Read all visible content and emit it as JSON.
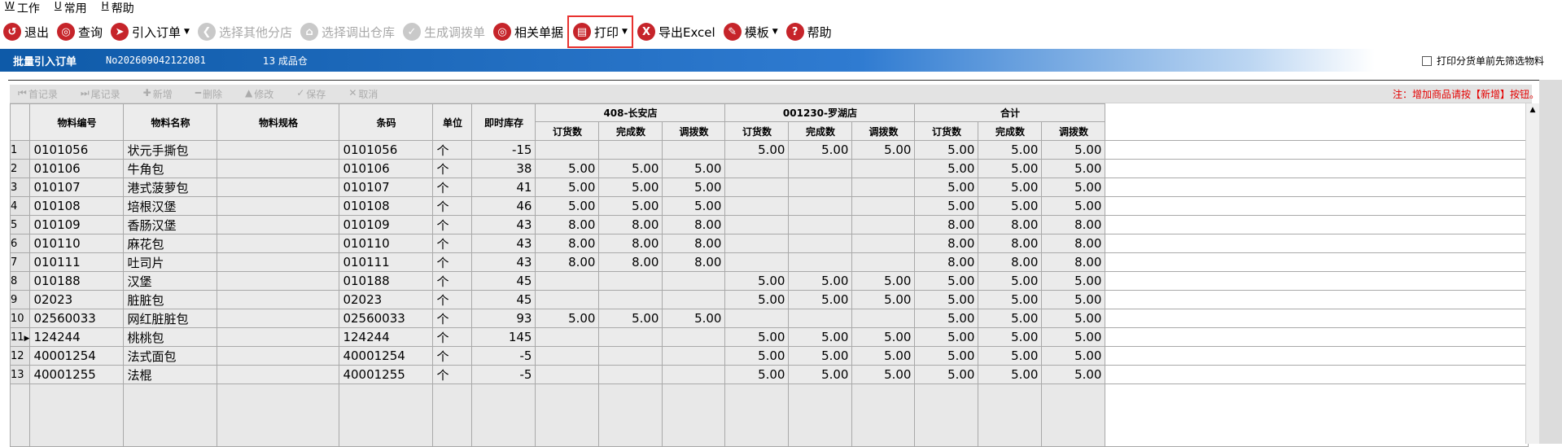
{
  "menu": [
    {
      "key": "W",
      "label": "工作"
    },
    {
      "key": "U",
      "label": "常用"
    },
    {
      "key": "H",
      "label": "帮助"
    }
  ],
  "toolbar": [
    {
      "label": "退出",
      "icon": "exit-icon",
      "glyph": "↺",
      "disabled": false
    },
    {
      "label": "查询",
      "icon": "search-icon",
      "glyph": "◎",
      "disabled": false
    },
    {
      "label": "引入订单",
      "icon": "import-order-icon",
      "glyph": "➤",
      "disabled": false,
      "dropdown": true
    },
    {
      "label": "选择其他分店",
      "icon": "back-icon",
      "glyph": "❮",
      "disabled": true
    },
    {
      "label": "选择调出仓库",
      "icon": "home-icon",
      "glyph": "⌂",
      "disabled": true
    },
    {
      "label": "生成调拨单",
      "icon": "check-icon",
      "glyph": "✓",
      "disabled": true
    },
    {
      "label": "相关单据",
      "icon": "related-docs-icon",
      "glyph": "◎",
      "disabled": false
    },
    {
      "label": "打印",
      "icon": "printer-icon",
      "glyph": "▤",
      "disabled": false,
      "dropdown": true,
      "highlight": true
    },
    {
      "label": "导出Excel",
      "icon": "export-excel-icon",
      "glyph": "X",
      "disabled": false
    },
    {
      "label": "模板",
      "icon": "template-icon",
      "glyph": "✎",
      "disabled": false,
      "dropdown": true
    },
    {
      "label": "帮助",
      "icon": "help-icon",
      "glyph": "?",
      "disabled": false
    }
  ],
  "strip": {
    "title": "批量引入订单",
    "doc_no": "No202609042122081",
    "warehouse": "13 成品仓",
    "checkbox_label": "打印分货单前先筛选物料"
  },
  "grid_toolbar": [
    {
      "label": "首记录",
      "glyph": "⏮"
    },
    {
      "label": "尾记录",
      "glyph": "⏭"
    },
    {
      "label": "新增",
      "glyph": "✚"
    },
    {
      "label": "删除",
      "glyph": "━"
    },
    {
      "label": "修改",
      "glyph": "▲"
    },
    {
      "label": "保存",
      "glyph": "✓"
    },
    {
      "label": "取消",
      "glyph": "✕"
    }
  ],
  "note": "注：增加商品请按【新增】按钮。",
  "table": {
    "headers": [
      "物料编号",
      "物料名称",
      "物料规格",
      "条码",
      "单位",
      "即时库存"
    ],
    "groups": [
      "408-长安店",
      "001230-罗湖店",
      "合计"
    ],
    "sub_headers": [
      "订货数",
      "完成数",
      "调拨数"
    ],
    "rows": [
      {
        "n": "1",
        "code": "0101056",
        "name": "状元手撕包",
        "spec": "",
        "barcode": "0101056",
        "unit": "个",
        "stock": "-15",
        "g1": [
          "",
          "",
          ""
        ],
        "g2": [
          "5.00",
          "5.00",
          "5.00"
        ],
        "g3": [
          "5.00",
          "5.00",
          "5.00"
        ]
      },
      {
        "n": "2",
        "code": "010106",
        "name": "牛角包",
        "spec": "",
        "barcode": "010106",
        "unit": "个",
        "stock": "38",
        "g1": [
          "5.00",
          "5.00",
          "5.00"
        ],
        "g2": [
          "",
          "",
          ""
        ],
        "g3": [
          "5.00",
          "5.00",
          "5.00"
        ]
      },
      {
        "n": "3",
        "code": "010107",
        "name": "港式菠萝包",
        "spec": "",
        "barcode": "010107",
        "unit": "个",
        "stock": "41",
        "g1": [
          "5.00",
          "5.00",
          "5.00"
        ],
        "g2": [
          "",
          "",
          ""
        ],
        "g3": [
          "5.00",
          "5.00",
          "5.00"
        ]
      },
      {
        "n": "4",
        "code": "010108",
        "name": "培根汉堡",
        "spec": "",
        "barcode": "010108",
        "unit": "个",
        "stock": "46",
        "g1": [
          "5.00",
          "5.00",
          "5.00"
        ],
        "g2": [
          "",
          "",
          ""
        ],
        "g3": [
          "5.00",
          "5.00",
          "5.00"
        ]
      },
      {
        "n": "5",
        "code": "010109",
        "name": "香肠汉堡",
        "spec": "",
        "barcode": "010109",
        "unit": "个",
        "stock": "43",
        "g1": [
          "8.00",
          "8.00",
          "8.00"
        ],
        "g2": [
          "",
          "",
          ""
        ],
        "g3": [
          "8.00",
          "8.00",
          "8.00"
        ]
      },
      {
        "n": "6",
        "code": "010110",
        "name": "麻花包",
        "spec": "",
        "barcode": "010110",
        "unit": "个",
        "stock": "43",
        "g1": [
          "8.00",
          "8.00",
          "8.00"
        ],
        "g2": [
          "",
          "",
          ""
        ],
        "g3": [
          "8.00",
          "8.00",
          "8.00"
        ]
      },
      {
        "n": "7",
        "code": "010111",
        "name": "吐司片",
        "spec": "",
        "barcode": "010111",
        "unit": "个",
        "stock": "43",
        "g1": [
          "8.00",
          "8.00",
          "8.00"
        ],
        "g2": [
          "",
          "",
          ""
        ],
        "g3": [
          "8.00",
          "8.00",
          "8.00"
        ]
      },
      {
        "n": "8",
        "code": "010188",
        "name": "汉堡",
        "spec": "",
        "barcode": "010188",
        "unit": "个",
        "stock": "45",
        "g1": [
          "",
          "",
          ""
        ],
        "g2": [
          "5.00",
          "5.00",
          "5.00"
        ],
        "g3": [
          "5.00",
          "5.00",
          "5.00"
        ]
      },
      {
        "n": "9",
        "code": "02023",
        "name": "脏脏包",
        "spec": "",
        "barcode": "02023",
        "unit": "个",
        "stock": "45",
        "g1": [
          "",
          "",
          ""
        ],
        "g2": [
          "5.00",
          "5.00",
          "5.00"
        ],
        "g3": [
          "5.00",
          "5.00",
          "5.00"
        ]
      },
      {
        "n": "10",
        "code": "02560033",
        "name": "网红脏脏包",
        "spec": "",
        "barcode": "02560033",
        "unit": "个",
        "stock": "93",
        "g1": [
          "5.00",
          "5.00",
          "5.00"
        ],
        "g2": [
          "",
          "",
          ""
        ],
        "g3": [
          "5.00",
          "5.00",
          "5.00"
        ]
      },
      {
        "n": "11",
        "code": "124244",
        "name": "桃桃包",
        "spec": "",
        "barcode": "124244",
        "unit": "个",
        "stock": "145",
        "g1": [
          "",
          "",
          ""
        ],
        "g2": [
          "5.00",
          "5.00",
          "5.00"
        ],
        "g3": [
          "5.00",
          "5.00",
          "5.00"
        ],
        "current": true
      },
      {
        "n": "12",
        "code": "40001254",
        "name": "法式面包",
        "spec": "",
        "barcode": "40001254",
        "unit": "个",
        "stock": "-5",
        "g1": [
          "",
          "",
          ""
        ],
        "g2": [
          "5.00",
          "5.00",
          "5.00"
        ],
        "g3": [
          "5.00",
          "5.00",
          "5.00"
        ]
      },
      {
        "n": "13",
        "code": "40001255",
        "name": "法棍",
        "spec": "",
        "barcode": "40001255",
        "unit": "个",
        "stock": "-5",
        "g1": [
          "",
          "",
          ""
        ],
        "g2": [
          "5.00",
          "5.00",
          "5.00"
        ],
        "g3": [
          "5.00",
          "5.00",
          "5.00"
        ]
      }
    ]
  }
}
